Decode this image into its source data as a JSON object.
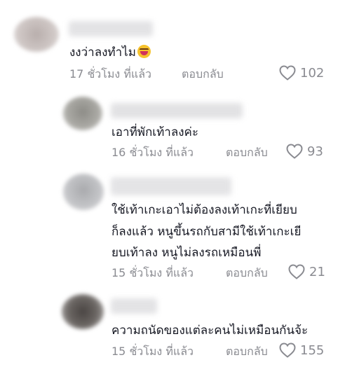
{
  "comments": [
    {
      "text": "งงว่าลงทำไม",
      "emoji": "laughing-emoji",
      "time": "17 ชั่วโมง ที่แล้ว",
      "reply_label": "ตอบกลับ",
      "likes": "102"
    },
    {
      "text": "เอาที่พักเท้าลงค่ะ",
      "time": "16 ชั่วโมง ที่แล้ว",
      "reply_label": "ตอบกลับ",
      "likes": "93"
    },
    {
      "lines": [
        "ใช้เท้าเกะเอาไม่ต้องลงเท้าเกะที่เยียบ",
        "ก็ลงแล้ว หนูขึ้นรถกับสามีใช้เท้าเกะเยี",
        "ยบเท้าลง หนูไม่ลงรถเหมือนพี่"
      ],
      "time": "15 ชั่วโมง ที่แล้ว",
      "reply_label": "ตอบกลับ",
      "likes": "21"
    },
    {
      "text": "ความถนัดของแต่ละคนไม่เหมือนกันจ้ะ",
      "time": "15 ชั่วโมง ที่แล้ว",
      "reply_label": "ตอบกลับ",
      "likes": "155"
    }
  ],
  "icons": {
    "like": "heart-outline-icon"
  },
  "colors": {
    "meta": "#8a8b91",
    "text": "#161823"
  }
}
